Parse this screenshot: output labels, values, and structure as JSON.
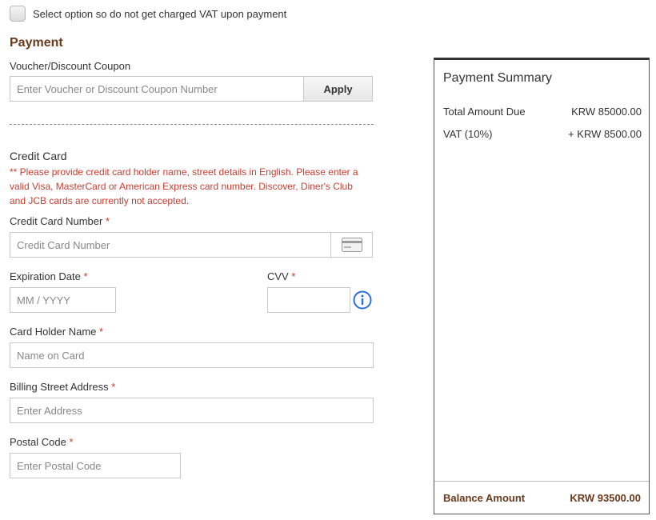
{
  "vat_option": {
    "label": "Select option so do not get charged VAT upon payment",
    "checked": false
  },
  "payment": {
    "title": "Payment",
    "voucher": {
      "label": "Voucher/Discount Coupon",
      "placeholder": "Enter Voucher or Discount Coupon Number",
      "value": "",
      "apply_label": "Apply"
    },
    "credit_card": {
      "heading": "Credit Card",
      "note": "** Please provide credit card holder name, street details in English. Please enter a valid Visa, MasterCard or American Express card number. Discover, Diner's Club and JCB cards are currently not accepted.",
      "required_mark": "*",
      "number": {
        "label": "Credit Card Number",
        "placeholder": "Credit Card Number",
        "value": ""
      },
      "expiration": {
        "label": "Expiration Date",
        "placeholder": "MM / YYYY",
        "value": ""
      },
      "cvv": {
        "label": "CVV",
        "placeholder": "",
        "value": ""
      },
      "holder_name": {
        "label": "Card Holder Name",
        "placeholder": "Name on Card",
        "value": ""
      },
      "street": {
        "label": "Billing Street Address",
        "placeholder": "Enter Address",
        "value": ""
      },
      "postal": {
        "label": "Postal Code",
        "placeholder": "Enter Postal Code",
        "value": ""
      }
    }
  },
  "summary": {
    "title": "Payment Summary",
    "rows": [
      {
        "label": "Total Amount Due",
        "value": "KRW 85000.00"
      },
      {
        "label": "VAT (10%)",
        "value": "+ KRW 8500.00"
      }
    ],
    "balance": {
      "label": "Balance Amount",
      "value": "KRW 93500.00"
    }
  },
  "icons": {
    "card": "credit-card-icon",
    "info": "info-icon"
  },
  "colors": {
    "accent_brown": "#6b3a1c",
    "required_red": "#c0392b",
    "note_red": "#d13b2f",
    "info_blue": "#2a6fdb"
  }
}
